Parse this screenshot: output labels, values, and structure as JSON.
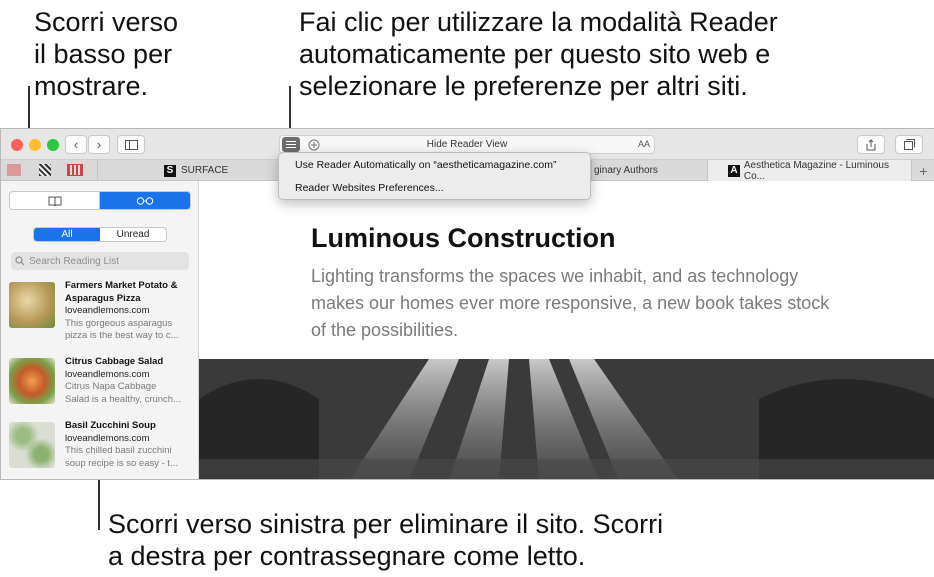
{
  "callouts": {
    "scroll_down": [
      "Scorri verso",
      "il basso per",
      "mostrare."
    ],
    "reader_auto": [
      "Fai clic per utilizzare la modalità Reader",
      "automaticamente per questo sito web e",
      "selezionare le preferenze per altri siti."
    ],
    "swipe": [
      "Scorri verso sinistra per eliminare il sito. Scorri",
      "a destra per contrassegnare come letto."
    ]
  },
  "toolbar": {
    "address_text": "Hide Reader View",
    "text_size_label": "AA"
  },
  "tabs": [
    {
      "label": "SURFACE",
      "favicon": "S"
    },
    {
      "label": "ginary Authors",
      "favicon": ""
    },
    {
      "label": "Aesthetica Magazine - Luminous Co...",
      "favicon": "A"
    }
  ],
  "dropdown": {
    "items": [
      "Use Reader Automatically on “aestheticamagazine.com”",
      "Reader Websites Preferences..."
    ]
  },
  "sidebar": {
    "filter": {
      "all": "All",
      "unread": "Unread"
    },
    "search_placeholder": "Search Reading List",
    "items": [
      {
        "title1": "Farmers Market Potato &",
        "title2": "Asparagus Pizza",
        "site": "loveandlemons.com",
        "desc1": "This gorgeous asparagus",
        "desc2": "pizza is the best way to c..."
      },
      {
        "title1": "Citrus Cabbage Salad",
        "title2": "",
        "site": "loveandlemons.com",
        "desc1": "Citrus Napa Cabbage",
        "desc2": "Salad is a healthy, crunch..."
      },
      {
        "title1": "Basil Zucchini Soup",
        "title2": "",
        "site": "loveandlemons.com",
        "desc1": "This chilled basil zucchini",
        "desc2": "soup recipe is so easy - t..."
      }
    ]
  },
  "article": {
    "title": "Luminous Construction",
    "subtitle": "Lighting transforms the spaces we inhabit, and as technology makes our homes ever more responsive, a new book takes stock of the possibilities."
  },
  "colors": {
    "accent": "#1a73e8",
    "close": "#ff5f57",
    "minimize": "#febc2e",
    "zoom": "#28c840"
  }
}
